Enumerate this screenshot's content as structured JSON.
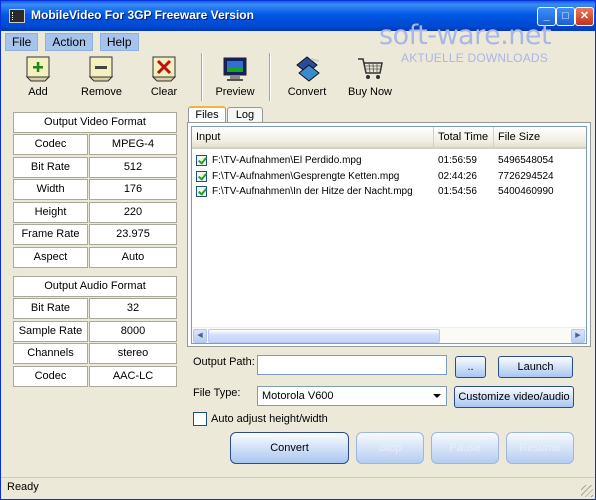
{
  "window": {
    "title": "MobileVideo For 3GP Freeware Version"
  },
  "watermark": {
    "brand": "soft-ware.net",
    "tagline": "AKTUELLE DOWNLOADS"
  },
  "menu": [
    "File",
    "Action",
    "Help"
  ],
  "toolbar": {
    "add": "Add",
    "remove": "Remove",
    "clear": "Clear",
    "preview": "Preview",
    "convert": "Convert",
    "buy": "Buy Now"
  },
  "video_format": {
    "title": "Output Video Format",
    "rows": [
      {
        "label": "Codec",
        "value": "MPEG-4"
      },
      {
        "label": "Bit Rate",
        "value": "512"
      },
      {
        "label": "Width",
        "value": "176"
      },
      {
        "label": "Height",
        "value": "220"
      },
      {
        "label": "Frame Rate",
        "value": "23.975"
      },
      {
        "label": "Aspect",
        "value": "Auto"
      }
    ]
  },
  "audio_format": {
    "title": "Output Audio Format",
    "rows": [
      {
        "label": "Bit Rate",
        "value": "32"
      },
      {
        "label": "Sample Rate",
        "value": "8000"
      },
      {
        "label": "Channels",
        "value": "stereo"
      },
      {
        "label": "Codec",
        "value": "AAC-LC"
      }
    ]
  },
  "tabs": [
    "Files",
    "Log"
  ],
  "files": {
    "headers": [
      "Input",
      "Total Time",
      "File Size"
    ],
    "rows": [
      {
        "path": "F:\\TV-Aufnahmen\\El Perdido.mpg",
        "time": "01:56:59",
        "size": "5496548054"
      },
      {
        "path": "F:\\TV-Aufnahmen\\Gesprengte Ketten.mpg",
        "time": "02:44:26",
        "size": "7726294524"
      },
      {
        "path": "F:\\TV-Aufnahmen\\In der Hitze der Nacht.mpg",
        "time": "01:54:56",
        "size": "5400460990"
      }
    ]
  },
  "output": {
    "path_label": "Output Path:",
    "path_value": "",
    "browse": "..",
    "launch": "Launch",
    "filetype_label": "File Type:",
    "filetype_value": "Motorola V600",
    "customize": "Customize video/audio",
    "auto_adjust": "Auto adjust height/width"
  },
  "actions": {
    "convert": "Convert",
    "stop": "Stop",
    "pause": "Pause",
    "resume": "Resume"
  },
  "status": "Ready"
}
